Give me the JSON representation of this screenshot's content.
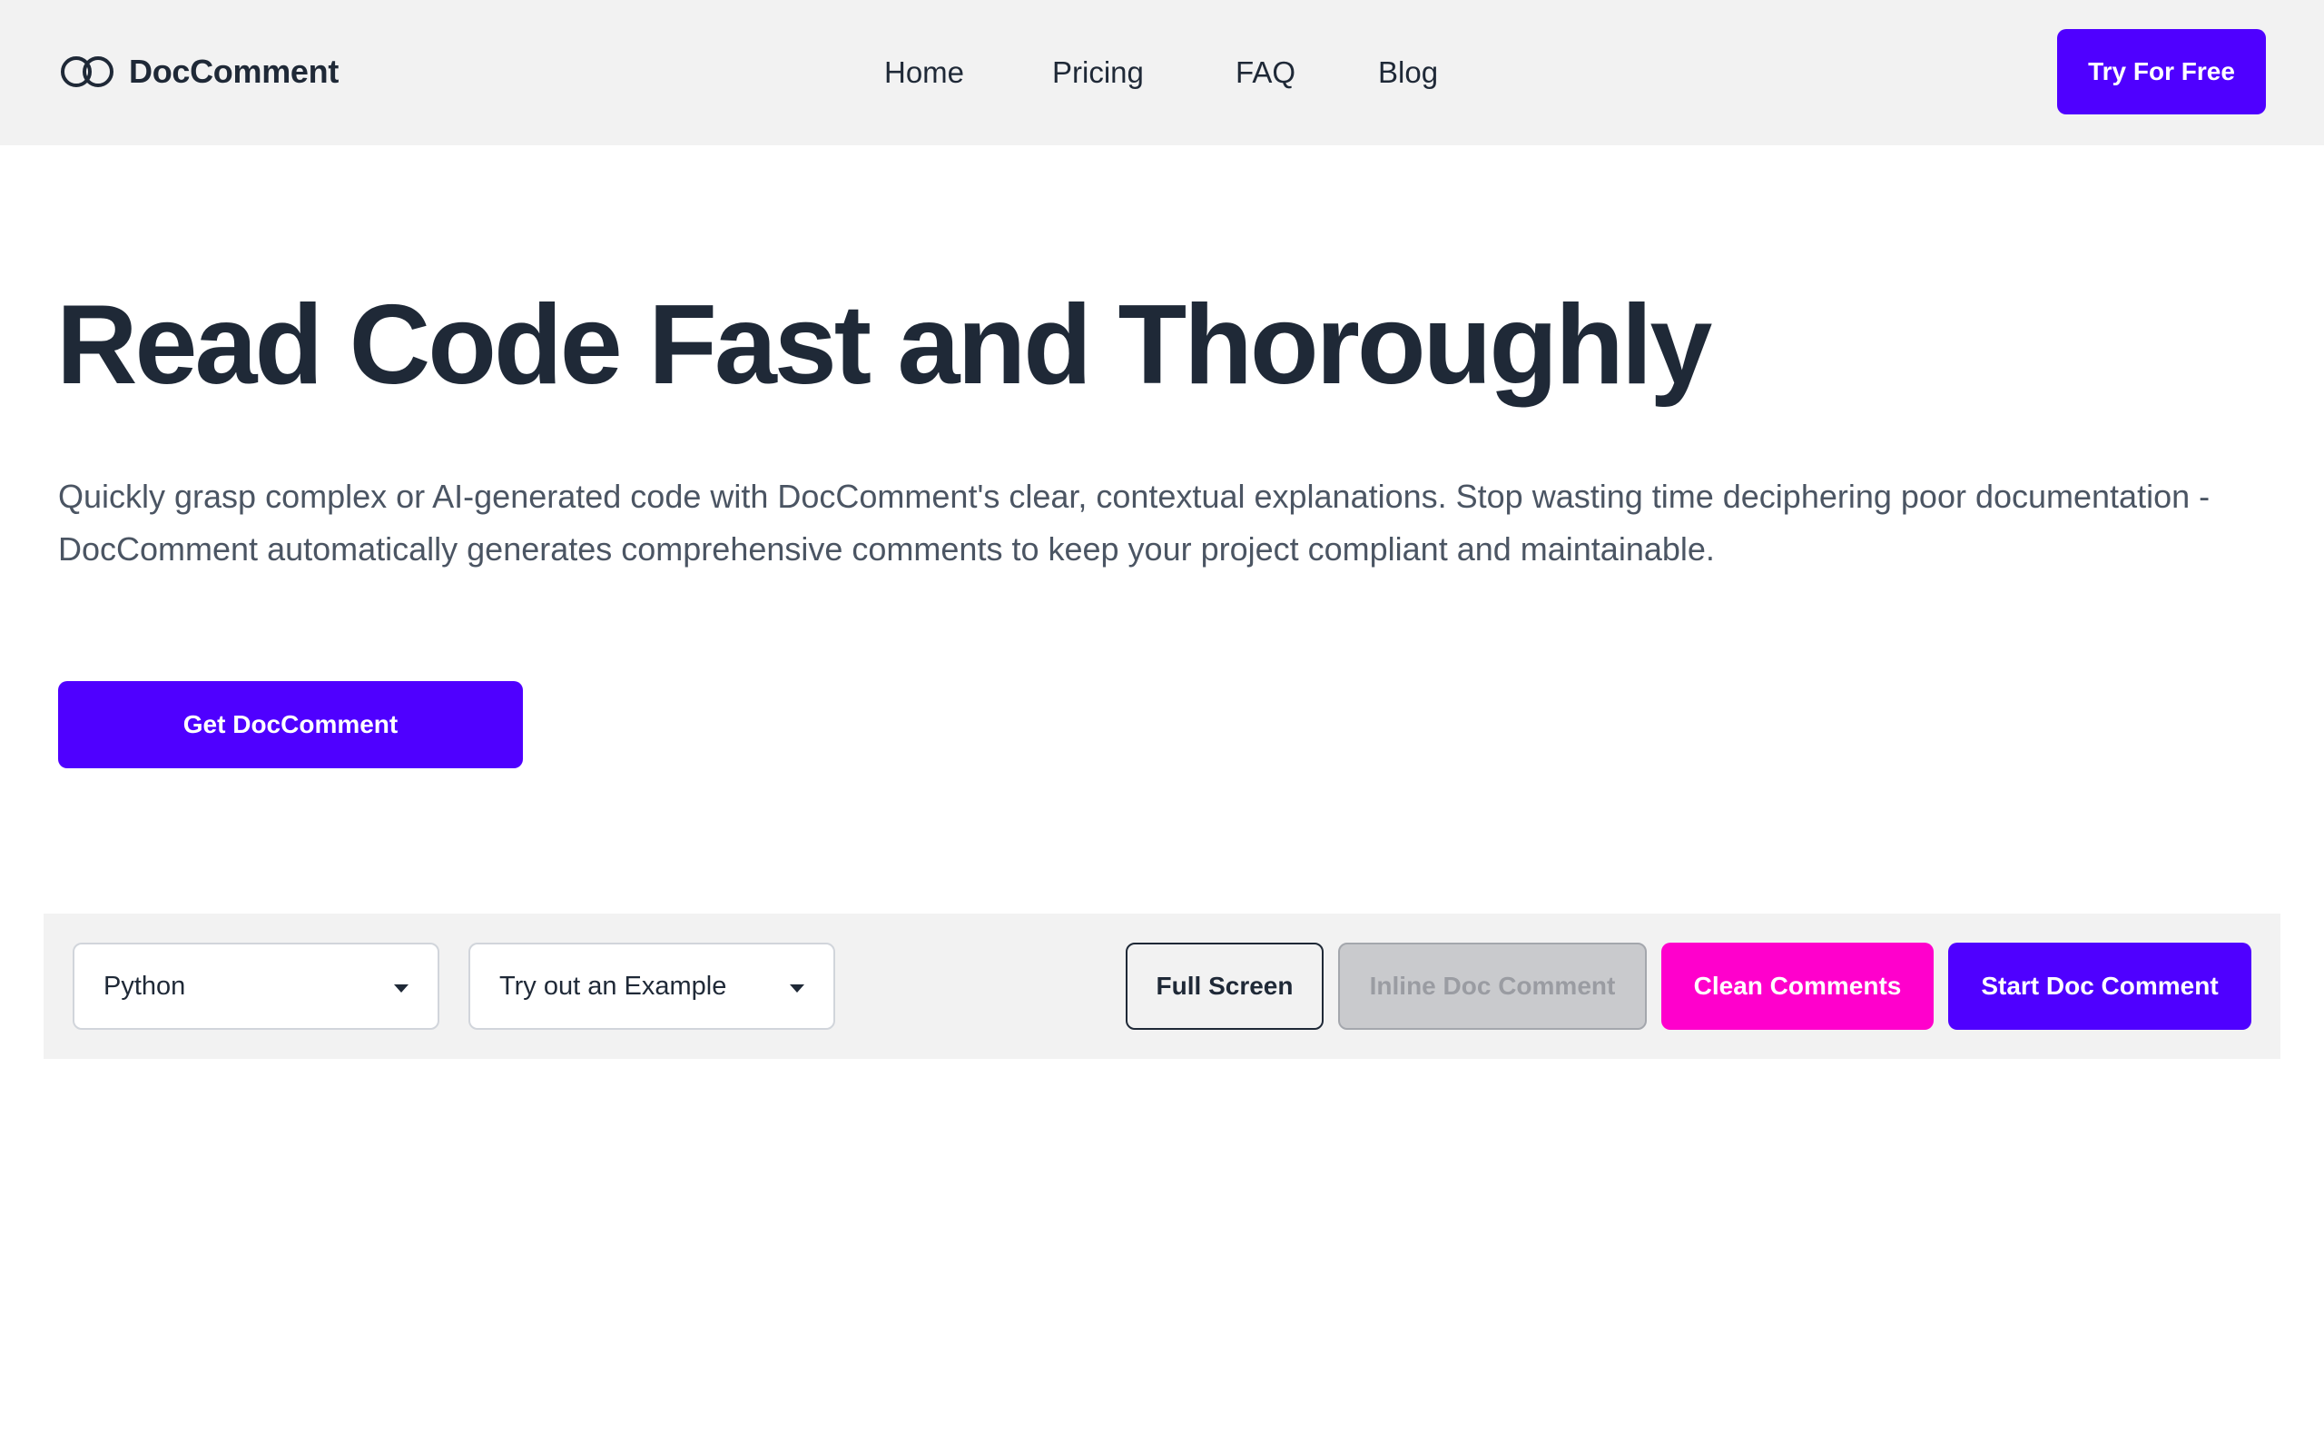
{
  "brand": {
    "name": "DocComment",
    "logo_icon": "infinity-rings-icon"
  },
  "nav": {
    "home": "Home",
    "pricing": "Pricing",
    "faq": "FAQ",
    "blog": "Blog"
  },
  "header": {
    "try_free_label": "Try For Free"
  },
  "hero": {
    "title": "Read Code Fast and Thoroughly",
    "description": "Quickly grasp complex or AI-generated code with DocComment's clear, contextual explanations. Stop wasting time deciphering poor documentation - DocComment automatically generates comprehensive comments to keep your project compliant and maintainable.",
    "cta_label": "Get DocComment"
  },
  "toolbar": {
    "language_select": {
      "value": "Python"
    },
    "example_select": {
      "value": "Try out an Example"
    },
    "full_screen_label": "Full Screen",
    "inline_doc_comment_label": "Inline Doc Comment",
    "clean_comments_label": "Clean Comments",
    "start_doc_comment_label": "Start Doc Comment"
  },
  "colors": {
    "primary": "#4f00ff",
    "accent_pink": "#ff00cc",
    "text_dark": "#1f2937",
    "text_muted": "#4b5563",
    "panel_bg": "#f2f2f2",
    "disabled_bg": "#c9cacd"
  }
}
